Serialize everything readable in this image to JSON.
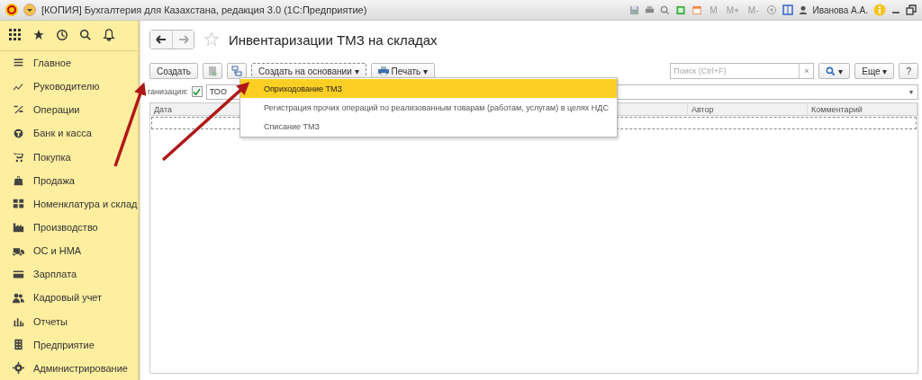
{
  "window": {
    "title": "[КОПИЯ] Бухгалтерия для Казахстана, редакция 3.0  (1С:Предприятие)",
    "memory_buttons": [
      "M",
      "M+",
      "M-"
    ],
    "user": "Иванова А.А."
  },
  "sidebar": {
    "items": [
      {
        "label": "Главное"
      },
      {
        "label": "Руководителю"
      },
      {
        "label": "Операции"
      },
      {
        "label": "Банк и касса"
      },
      {
        "label": "Покупка"
      },
      {
        "label": "Продажа"
      },
      {
        "label": "Номенклатура и склад"
      },
      {
        "label": "Производство"
      },
      {
        "label": "ОС и НМА"
      },
      {
        "label": "Зарплата"
      },
      {
        "label": "Кадровый учет"
      },
      {
        "label": "Отчеты"
      },
      {
        "label": "Предприятие"
      },
      {
        "label": "Администрирование"
      }
    ]
  },
  "form": {
    "title": "Инвентаризации ТМЗ на складах",
    "toolbar": {
      "create": "Создать",
      "create_based": "Создать на основании ▾",
      "print": "Печать ▾",
      "search": {
        "placeholder": "Поиск (Ctrl+F)"
      },
      "clear": "×",
      "search_menu": "▾",
      "more": "Еще ▾",
      "help": "?"
    },
    "filter": {
      "label": "ганизация:",
      "checked": true,
      "value": "ТОО",
      "dropdown_glyph": "▾"
    },
    "table": {
      "columns": [
        "Дата",
        "Автор",
        "Комментарий"
      ]
    },
    "dropdown": {
      "items": [
        {
          "label": "Оприходование ТМЗ",
          "selected": true
        },
        {
          "label": "Регистрация прочих операций по реализованным товарам (работам, услугам) в целях НДС",
          "selected": false
        },
        {
          "label": "Списание ТМЗ",
          "selected": false
        }
      ]
    }
  }
}
